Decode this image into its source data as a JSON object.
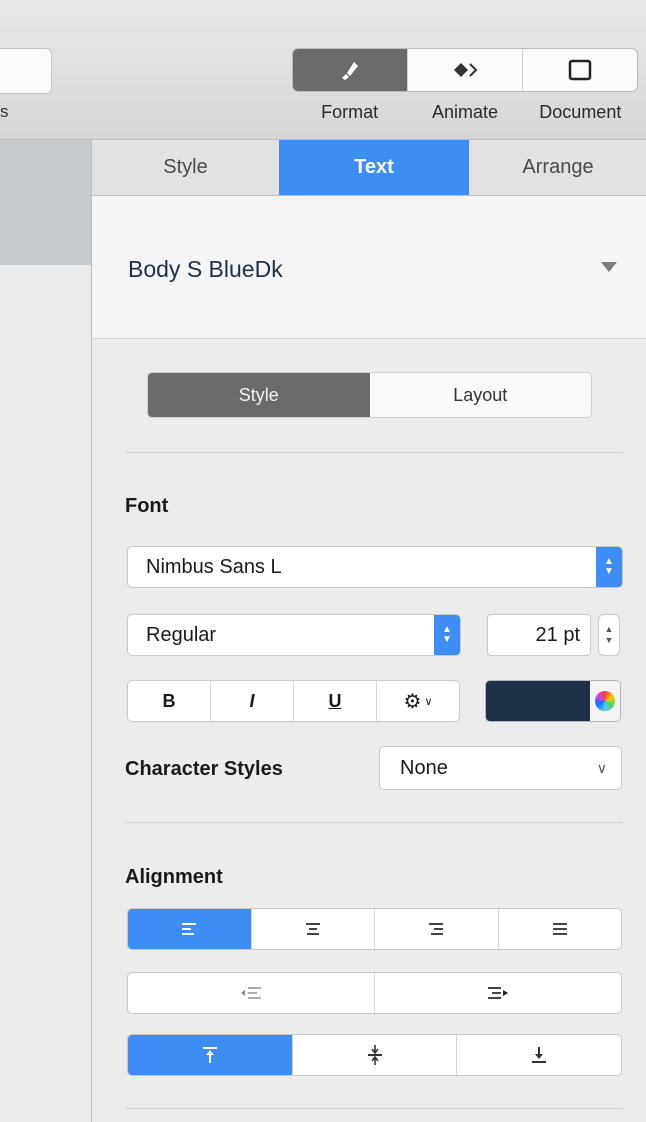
{
  "toolbar": {
    "clipped_label": "s",
    "buttons": [
      {
        "label": "Format",
        "icon": "paintbrush-icon",
        "active": true
      },
      {
        "label": "Animate",
        "icon": "diamond-arrow-icon",
        "active": false
      },
      {
        "label": "Document",
        "icon": "document-frame-icon",
        "active": false
      }
    ]
  },
  "inspector": {
    "tabs": [
      {
        "label": "Style",
        "active": false
      },
      {
        "label": "Text",
        "active": true
      },
      {
        "label": "Arrange",
        "active": false
      }
    ],
    "paragraph_style": {
      "name": "Body S BlueDk"
    },
    "segment": {
      "style_label": "Style",
      "layout_label": "Layout",
      "selected": "Style"
    },
    "font": {
      "section_title": "Font",
      "family": "Nimbus Sans L",
      "typeface": "Regular",
      "size": "21 pt",
      "format_buttons": {
        "bold": "B",
        "italic": "I",
        "underline": "U"
      },
      "color": "#1e3046"
    },
    "character_styles": {
      "label": "Character Styles",
      "value": "None"
    },
    "alignment": {
      "section_title": "Alignment",
      "horizontal": [
        "align-left",
        "align-center",
        "align-right",
        "justify"
      ],
      "horizontal_selected": "align-left",
      "indent": [
        "decrease-indent",
        "increase-indent"
      ],
      "vertical": [
        "align-top",
        "align-middle",
        "align-bottom"
      ],
      "vertical_selected": "align-top"
    }
  },
  "colors": {
    "accent": "#3d8df5",
    "segment_dark": "#6b6b6b"
  }
}
